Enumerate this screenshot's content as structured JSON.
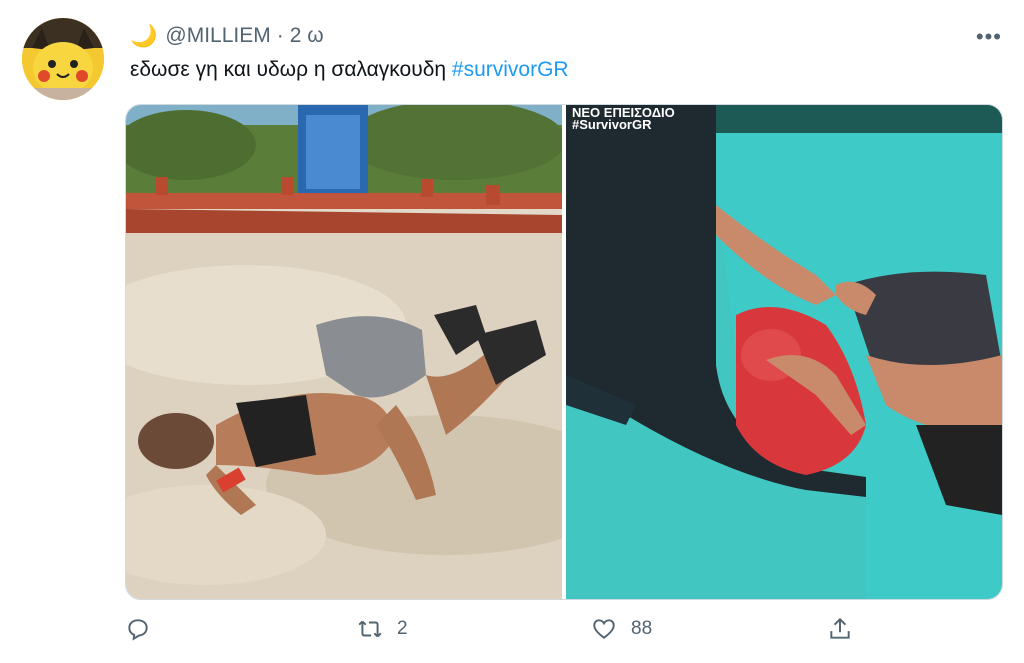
{
  "author": {
    "emoji": "🌙",
    "handle": "@MILLIEM",
    "separator": "·",
    "time": "2 ω"
  },
  "tweet": {
    "text": "εδωσε γη και υδωρ η σαλαγκουδη ",
    "hashtag": "#survivorGR"
  },
  "media": {
    "overlay_line1": "ΝΕΟ ΕΠΕΙΣΟΔΙΟ",
    "overlay_line2": "#SurvivorGR"
  },
  "actions": {
    "reply_count": "",
    "retweet_count": "2",
    "like_count": "88"
  },
  "colors": {
    "link": "#1d9bf0",
    "secondary": "#536471"
  }
}
